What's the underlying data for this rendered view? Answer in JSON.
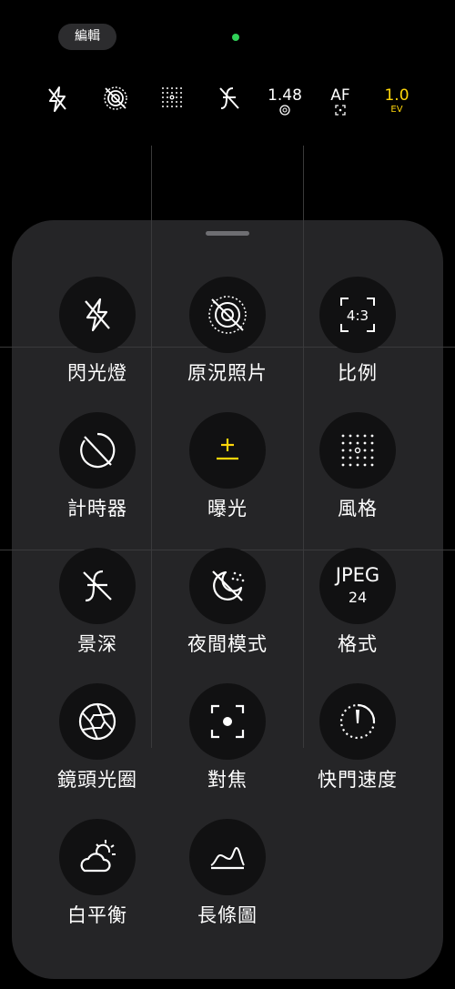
{
  "top": {
    "edit_label": "編輯",
    "aperture_value": "1.48",
    "af_label": "AF",
    "ev_value": "1.0",
    "ev_unit": "EV"
  },
  "topbar_icons": [
    "flash-off-icon",
    "live-photo-off-icon",
    "style-grid-icon",
    "depth-off-icon",
    "aperture-icon",
    "focus-frame-icon"
  ],
  "colors": {
    "accent": "#ffd60a",
    "recording_dot": "#30d158",
    "panel": "#28282a"
  },
  "controls": [
    {
      "label": "閃光燈",
      "icon": "flash-off-icon"
    },
    {
      "label": "原況照片",
      "icon": "live-photo-off-icon"
    },
    {
      "label": "比例",
      "icon": "aspect-ratio-icon",
      "icon_text": "4:3"
    },
    {
      "label": "計時器",
      "icon": "timer-off-icon"
    },
    {
      "label": "曝光",
      "icon": "exposure-icon"
    },
    {
      "label": "風格",
      "icon": "style-grid-icon"
    },
    {
      "label": "景深",
      "icon": "depth-off-icon"
    },
    {
      "label": "夜間模式",
      "icon": "night-mode-off-icon"
    },
    {
      "label": "格式",
      "icon": "format-icon",
      "icon_text": "JPEG",
      "icon_subtext": "24"
    },
    {
      "label": "鏡頭光圈",
      "icon": "aperture-icon"
    },
    {
      "label": "對焦",
      "icon": "focus-icon"
    },
    {
      "label": "快門速度",
      "icon": "shutter-speed-icon"
    },
    {
      "label": "白平衡",
      "icon": "white-balance-icon"
    },
    {
      "label": "長條圖",
      "icon": "histogram-icon"
    }
  ]
}
